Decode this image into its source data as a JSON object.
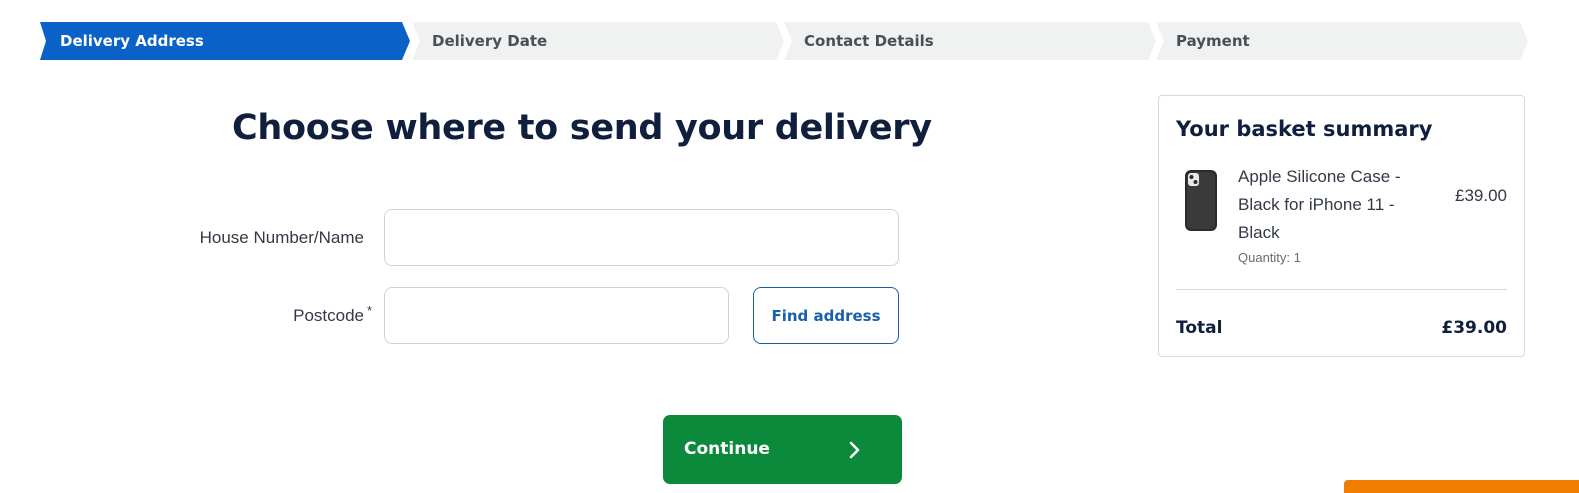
{
  "stepper": {
    "steps": [
      {
        "label": "Delivery Address",
        "state": "active"
      },
      {
        "label": "Delivery Date",
        "state": "inactive"
      },
      {
        "label": "Contact Details",
        "state": "inactive"
      },
      {
        "label": "Payment",
        "state": "inactive"
      }
    ]
  },
  "page": {
    "title": "Choose where to send your delivery"
  },
  "form": {
    "house_label": "House Number/Name",
    "house_value": "",
    "house_placeholder": "",
    "postcode_label": "Postcode",
    "postcode_required_mark": "*",
    "postcode_value": "",
    "postcode_placeholder": "",
    "find_address_label": "Find address",
    "continue_label": "Continue",
    "continue_icon": "chevron-right-icon"
  },
  "basket": {
    "title": "Your basket summary",
    "items": [
      {
        "name": "Apple Silicone Case - Black for iPhone 11 - Black",
        "quantity_text": "Quantity: 1",
        "price": "£39.00",
        "image_icon": "phone-case-image"
      }
    ],
    "total_label": "Total",
    "total_value": "£39.00"
  },
  "colors": {
    "active_step": "#0a62c9",
    "inactive_step": "#f0f1f1",
    "continue_button": "#0b8a3c",
    "find_address_border": "#1a5fa8",
    "heading": "#0f1f3d",
    "corner_widget": "#f07d00"
  }
}
